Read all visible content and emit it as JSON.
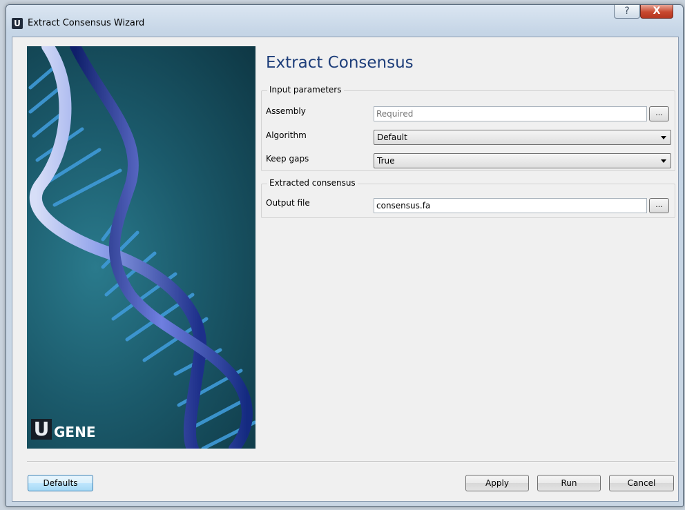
{
  "window": {
    "title": "Extract Consensus Wizard",
    "app_icon_letter": "U",
    "help_glyph": "?",
    "close_glyph": "X"
  },
  "banner": {
    "logo_letter": "U",
    "logo_text": "GENE"
  },
  "page": {
    "title": "Extract Consensus"
  },
  "input_parameters": {
    "group_title": "Input parameters",
    "assembly": {
      "label": "Assembly",
      "value": "",
      "placeholder": "Required",
      "browse_label": "..."
    },
    "algorithm": {
      "label": "Algorithm",
      "selected": "Default"
    },
    "keep_gaps": {
      "label": "Keep gaps",
      "selected": "True"
    }
  },
  "extracted_consensus": {
    "group_title": "Extracted consensus",
    "output_file": {
      "label": "Output file",
      "value": "consensus.fa",
      "browse_label": "..."
    }
  },
  "buttons": {
    "defaults": "Defaults",
    "apply": "Apply",
    "run": "Run",
    "cancel": "Cancel"
  },
  "colors": {
    "title_accent": "#1e3e7a",
    "close_button": "#c8482f",
    "banner_bg": "#1b5a6b",
    "helix": "#1f3f9e"
  }
}
